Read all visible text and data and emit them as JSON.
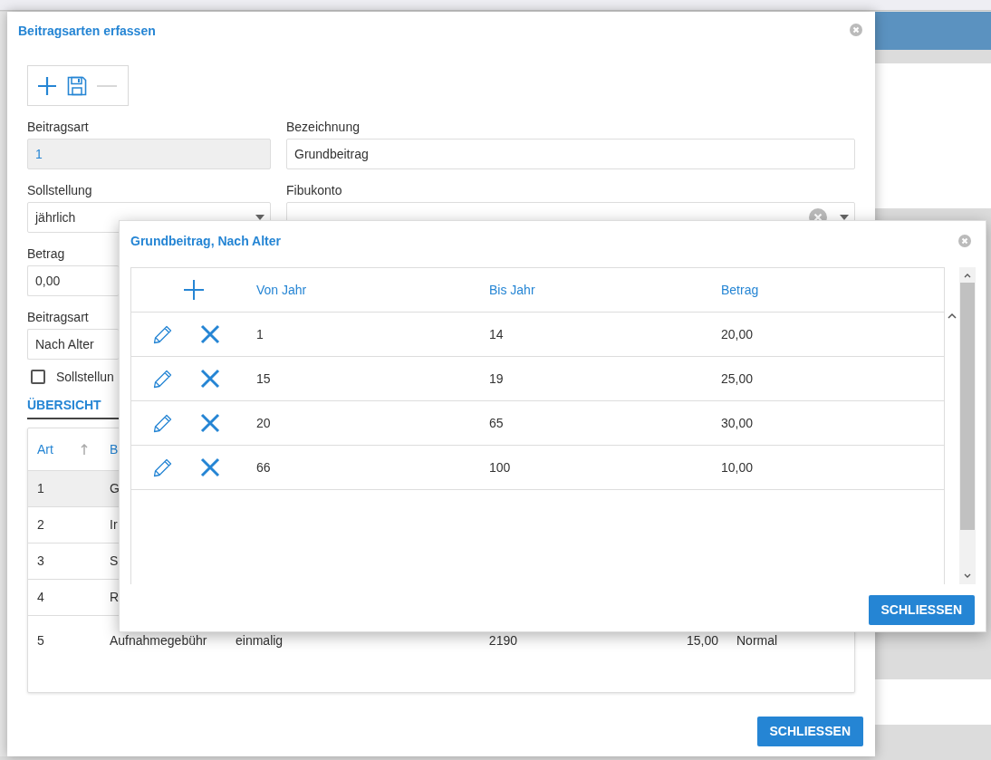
{
  "main_dialog": {
    "title": "Beitragsarten erfassen",
    "toolbar": [
      {
        "kind": "add",
        "disabled": false
      },
      {
        "kind": "save",
        "disabled": false
      },
      {
        "kind": "remove",
        "disabled": true
      }
    ],
    "fields": [
      {
        "label": "Beitragsart",
        "value": "1",
        "kind": "readonly"
      },
      {
        "label": "Bezeichnung",
        "value": "Grundbeitrag",
        "kind": "text"
      },
      {
        "label": "Sollstellung",
        "value": "jährlich",
        "kind": "select"
      },
      {
        "label": "Fibukonto",
        "kind": "combo"
      },
      {
        "label": "Betrag",
        "value": "0,00",
        "kind": "text"
      },
      {
        "label": "Beitragsart",
        "value": "Nach Alter",
        "kind": "select"
      }
    ],
    "checkbox": {
      "label": "Sollstellun",
      "checked": false
    },
    "tab": {
      "label": "ÜBERSICHT",
      "selected": true
    },
    "table": {
      "columns": [
        "Art",
        "B"
      ],
      "sorted_ascending": true,
      "rows": [
        {
          "cells": [
            "1",
            "G"
          ],
          "selected": true
        },
        {
          "cells": [
            "2",
            "Ir"
          ],
          "selected": false
        },
        {
          "cells": [
            "3",
            "S"
          ],
          "selected": false
        },
        {
          "cells": [
            "4",
            "R"
          ],
          "selected": false
        },
        {
          "cells": [
            "5",
            "Aufnahmegebühr",
            "einmalig",
            "2190",
            "15,00",
            "Normal"
          ],
          "selected": false
        }
      ]
    },
    "button": "SCHLIESSEN"
  },
  "sub_dialog": {
    "title": "Grundbeitrag, Nach Alter",
    "table": {
      "columns": [
        "Von Jahr",
        "Bis Jahr",
        "Betrag"
      ],
      "rows": [
        {
          "cells": [
            "1",
            "14",
            "20,00"
          ]
        },
        {
          "cells": [
            "15",
            "19",
            "25,00"
          ]
        },
        {
          "cells": [
            "20",
            "65",
            "30,00"
          ]
        },
        {
          "cells": [
            "66",
            "100",
            "10,00"
          ]
        }
      ]
    },
    "button": "SCHLIESSEN"
  }
}
